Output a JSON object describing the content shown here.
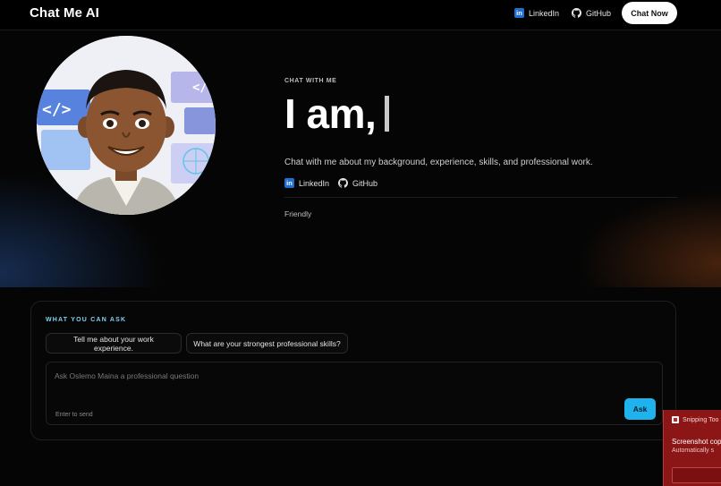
{
  "nav": {
    "brand": "Chat Me AI",
    "linkedin_label": "LinkedIn",
    "github_label": "GitHub",
    "chat_now_label": "Chat Now"
  },
  "hero": {
    "eyebrow": "CHAT WITH ME",
    "headline": "I am,",
    "tagline": "Chat with me about my background, experience, skills, and professional work.",
    "linkedin_label": "LinkedIn",
    "github_label": "GitHub",
    "mode": "Friendly",
    "avatar_icon": "code-brackets-icon"
  },
  "ask": {
    "title": "WHAT YOU CAN ASK",
    "suggestions": [
      "Tell me about your work experience.",
      "What are your strongest professional skills?"
    ],
    "input_placeholder": "Ask Oslemo Maina a professional question",
    "input_value": "",
    "hint": "Enter to send",
    "ask_label": "Ask"
  },
  "toast": {
    "app": "Snipping Too",
    "title": "Screenshot cop",
    "body": "Automatically s"
  },
  "colors": {
    "accent": "#1fb2ec",
    "section_title": "#7fd3ec",
    "linkedin": "#1f6fd1",
    "toast_bg": "#8c1515"
  }
}
